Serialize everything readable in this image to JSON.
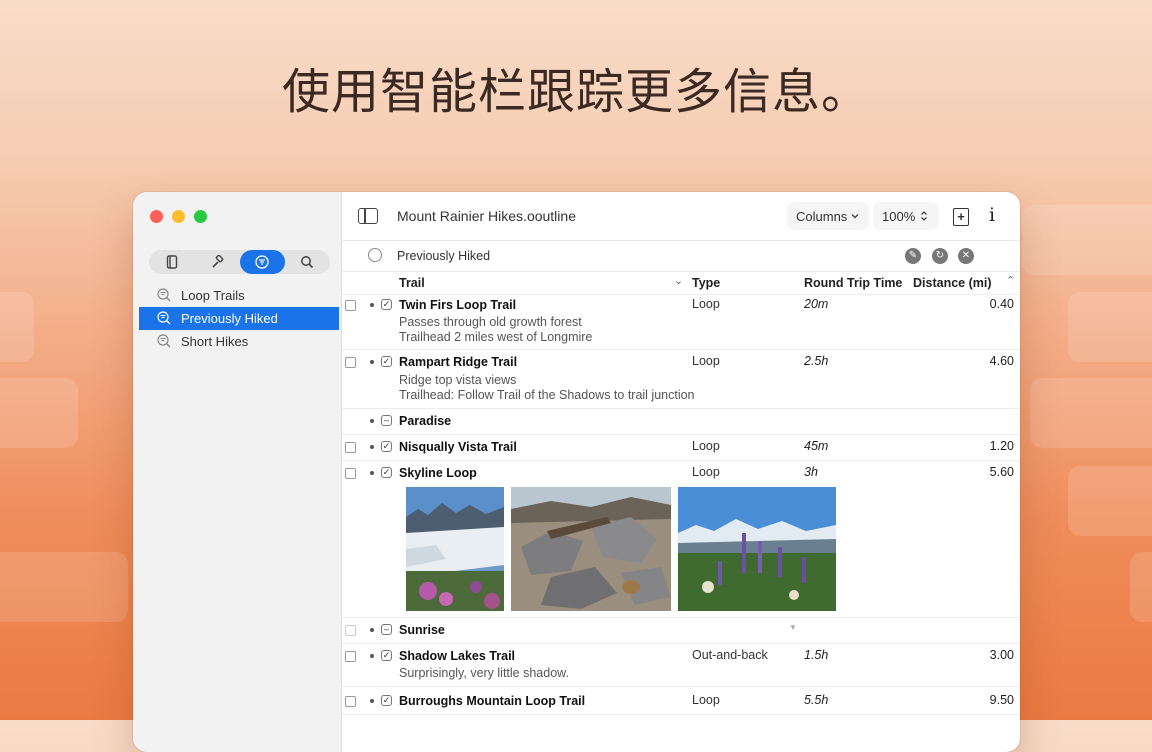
{
  "headline": "使用智能栏跟踪更多信息。",
  "window": {
    "title": "Mount Rainier Hikes.ooutline",
    "columns_label": "Columns",
    "zoom_label": "100%",
    "info_label": "i",
    "add_label": "+"
  },
  "sidebar": {
    "segments": [
      "outline-icon",
      "hammer-icon",
      "filter-icon",
      "search-icon"
    ],
    "items": [
      {
        "label": "Loop Trails"
      },
      {
        "label": "Previously Hiked"
      },
      {
        "label": "Short Hikes"
      }
    ]
  },
  "filter": {
    "label": "Previously Hiked"
  },
  "columns": {
    "trail": "Trail",
    "type": "Type",
    "time": "Round Trip Time",
    "distance": "Distance (mi)"
  },
  "rows": [
    {
      "title": "Twin Firs Loop Trail",
      "notes": [
        "Passes through old growth forest",
        "Trailhead 2 miles west of Longmire"
      ],
      "type": "Loop",
      "time": "20m",
      "distance": "0.40"
    },
    {
      "title": "Rampart Ridge Trail",
      "notes": [
        "Ridge top vista views",
        "Trailhead: Follow Trail of the Shadows to trail junction"
      ],
      "type": "Loop",
      "time": "2.5h",
      "distance": "4.60"
    },
    {
      "title": "Paradise"
    },
    {
      "title": "Nisqually Vista Trail",
      "type": "Loop",
      "time": "45m",
      "distance": "1.20"
    },
    {
      "title": "Skyline Loop",
      "type": "Loop",
      "time": "3h",
      "distance": "5.60"
    },
    {
      "title": "Sunrise"
    },
    {
      "title": "Shadow Lakes Trail",
      "notes": [
        "Surprisingly, very little shadow."
      ],
      "type": "Out-and-back",
      "time": "1.5h",
      "distance": "3.00"
    },
    {
      "title": "Burroughs Mountain Loop Trail",
      "type": "Loop",
      "time": "5.5h",
      "distance": "9.50"
    }
  ],
  "colors": {
    "accent": "#1a73e8",
    "close": "#fe5f57",
    "minimize": "#febc2e",
    "zoom": "#28c840"
  }
}
